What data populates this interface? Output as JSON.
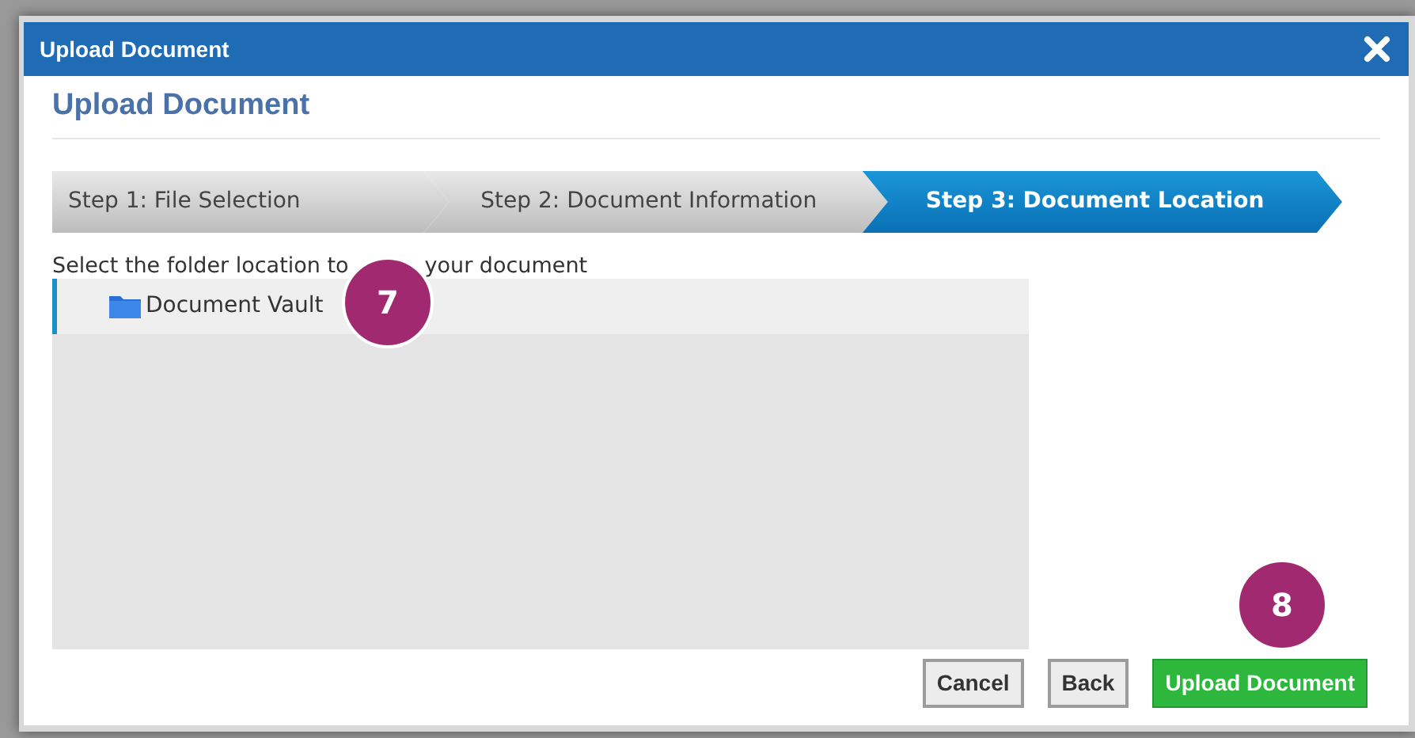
{
  "window": {
    "title": "Upload Document"
  },
  "heading": "Upload Document",
  "steps": [
    {
      "label": "Step 1: File Selection",
      "selected": false
    },
    {
      "label": "Step 2: Document Information",
      "selected": false
    },
    {
      "label": "Step 3: Document Location",
      "selected": true
    }
  ],
  "instruction": {
    "before": "Select the folder location to",
    "after": "your document"
  },
  "folders": [
    {
      "name": "Document Vault",
      "selected": true
    }
  ],
  "buttons": [
    {
      "label": "Cancel",
      "kind": "secondary"
    },
    {
      "label": "Back",
      "kind": "secondary"
    },
    {
      "label": "Upload Document",
      "kind": "primary"
    }
  ],
  "callouts": [
    "7",
    "8"
  ]
}
